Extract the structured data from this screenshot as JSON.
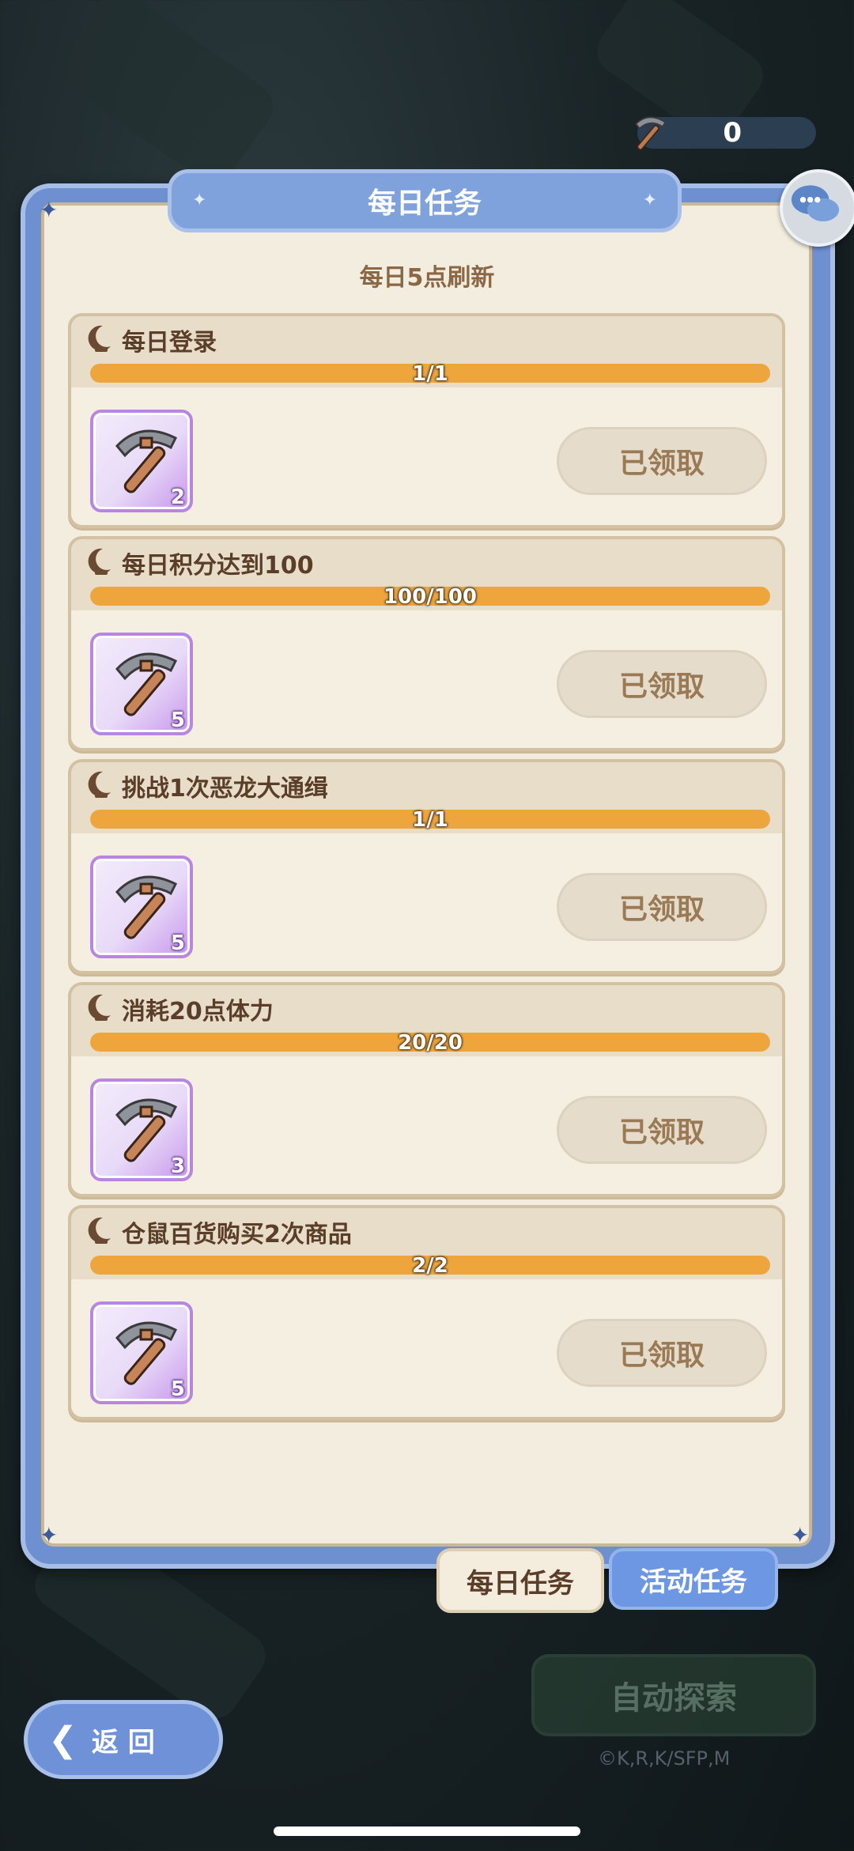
{
  "currency": {
    "icon": "pickaxe-icon",
    "value": "0"
  },
  "panel": {
    "title": "每日任务",
    "refresh_note": "每日5点刷新"
  },
  "tasks": [
    {
      "name": "每日登录",
      "progress_text": "1/1",
      "progress": 1.0,
      "reward_icon": "pickaxe-icon",
      "reward_qty": "2",
      "status": "已领取"
    },
    {
      "name": "每日积分达到100",
      "progress_text": "100/100",
      "progress": 1.0,
      "reward_icon": "pickaxe-icon",
      "reward_qty": "5",
      "status": "已领取"
    },
    {
      "name": "挑战1次恶龙大通缉",
      "progress_text": "1/1",
      "progress": 1.0,
      "reward_icon": "pickaxe-icon",
      "reward_qty": "5",
      "status": "已领取"
    },
    {
      "name": "消耗20点体力",
      "progress_text": "20/20",
      "progress": 1.0,
      "reward_icon": "pickaxe-icon",
      "reward_qty": "3",
      "status": "已领取"
    },
    {
      "name": "仓鼠百货购买2次商品",
      "progress_text": "2/2",
      "progress": 1.0,
      "reward_icon": "pickaxe-icon",
      "reward_qty": "5",
      "status": "已领取"
    }
  ],
  "tabs": {
    "daily": "每日任务",
    "event": "活动任务"
  },
  "auto_explore": "自动探索",
  "copyright": "©K,R,K/SFP,M",
  "back": "返 回",
  "colors": {
    "accent_blue": "#6e8fd0",
    "progress": "#eea53c",
    "panel_bg": "#f3eddf"
  }
}
